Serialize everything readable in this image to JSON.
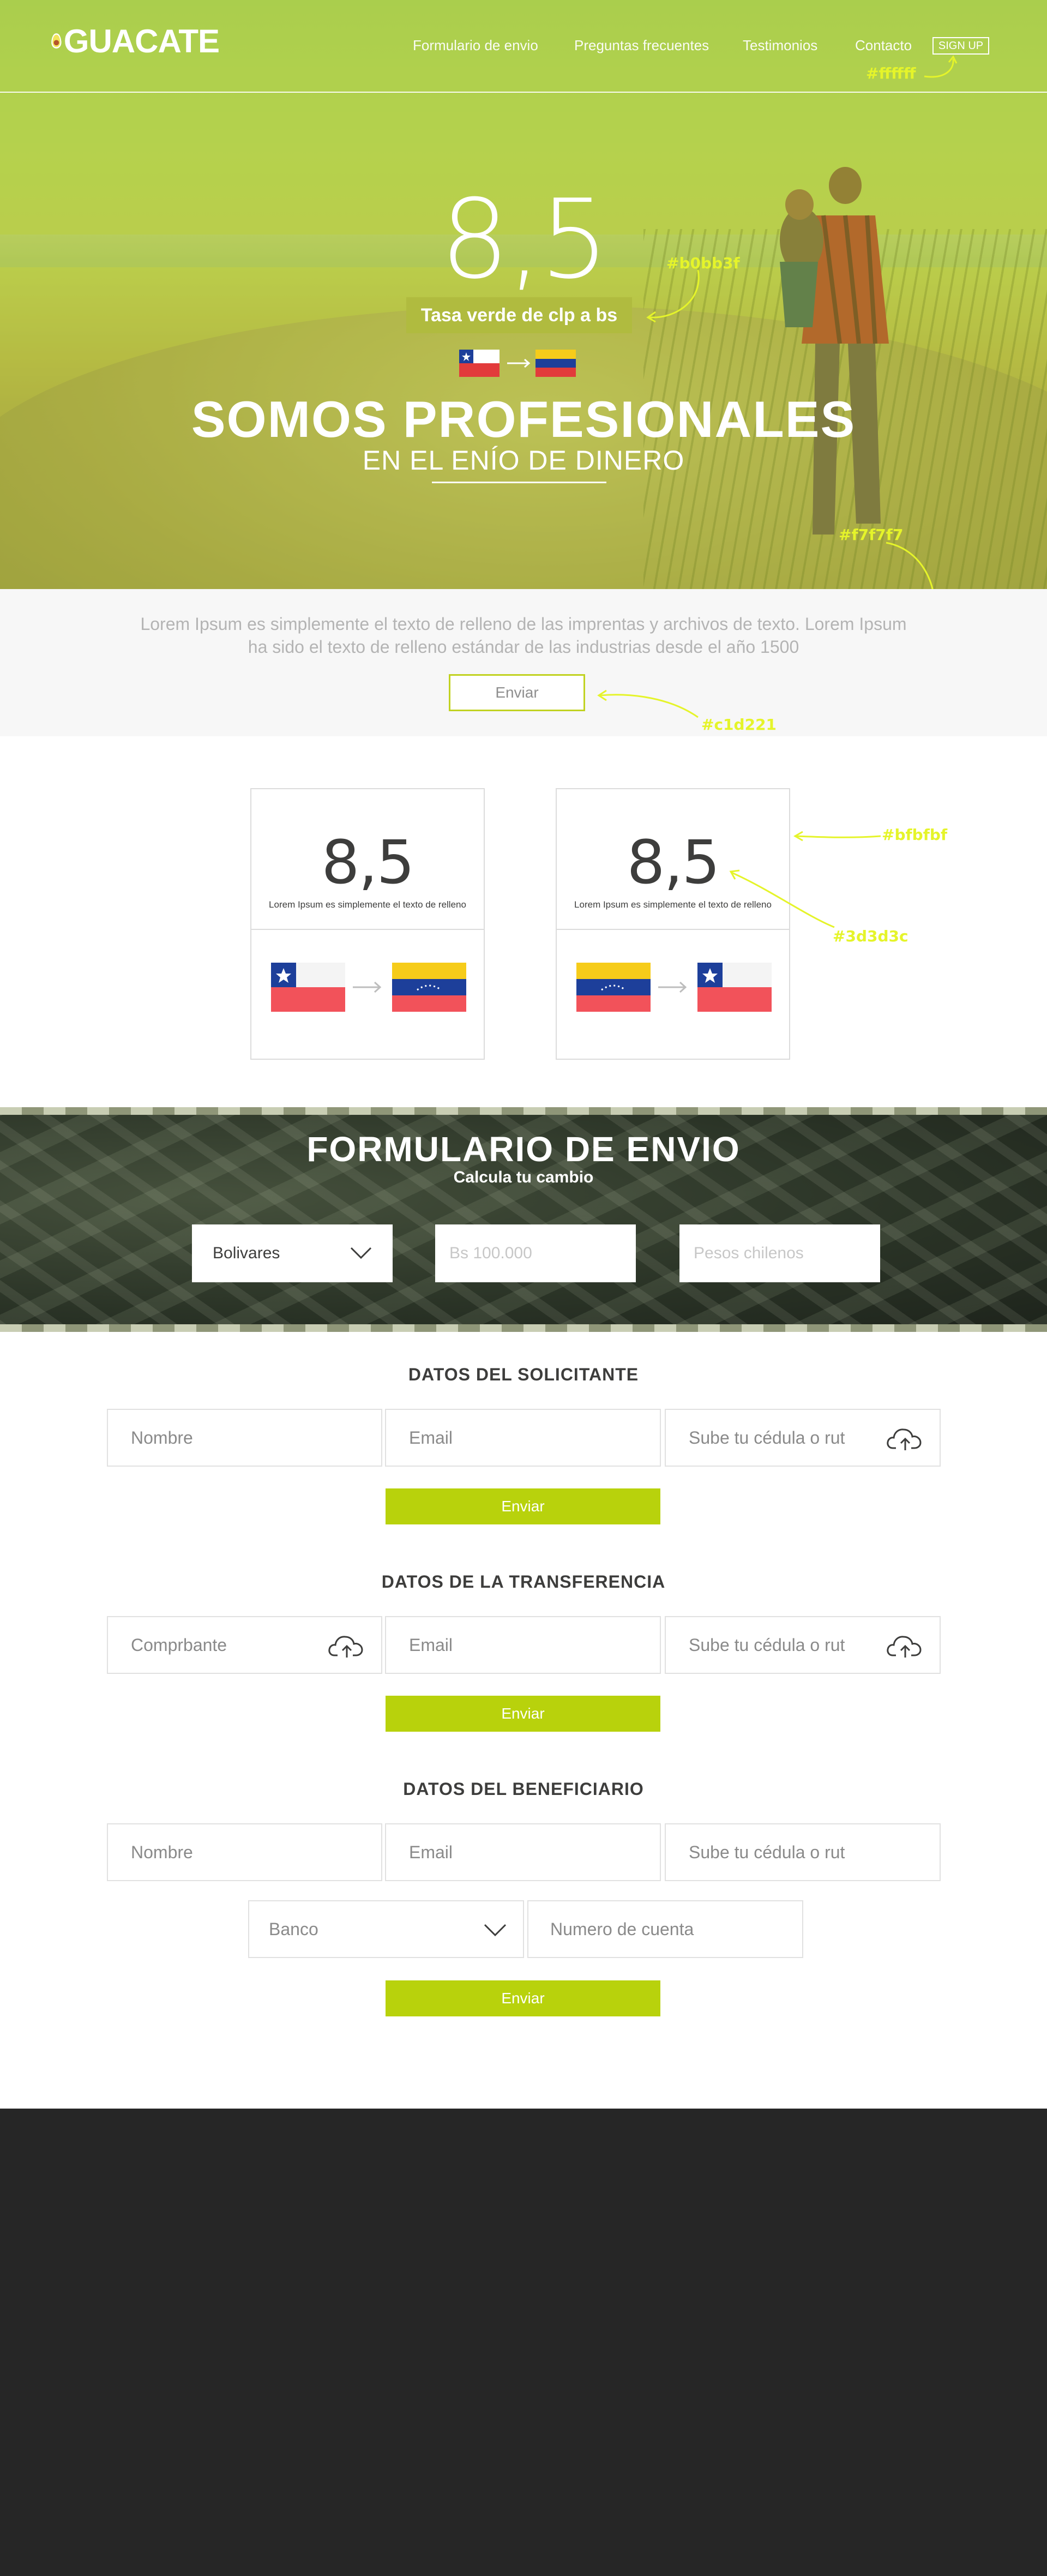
{
  "header": {
    "logo_text": "GUACATE",
    "nav": [
      "Formulario de envio",
      "Preguntas frecuentes",
      "Testimonios",
      "Contacto"
    ],
    "signup": "SIGN UP"
  },
  "hero": {
    "rate": "8,5",
    "rate_label": "Tasa verde de clp a bs",
    "title": "SOMOS PROFESIONALES",
    "subtitle": "EN EL ENÍO DE DINERO"
  },
  "annotations": {
    "white": "#ffffff",
    "tag_color": "#b0bb3f",
    "band_color": "#f7f7f7",
    "button_border": "#c1d221",
    "card_border": "#bfbfbf",
    "card_text": "#3d3d3c"
  },
  "intro": {
    "text": "Lorem Ipsum es simplemente el texto de relleno de las imprentas y archivos de texto. Lorem Ipsum ha sido el texto de relleno estándar de las industrias desde el año 1500",
    "button": "Enviar"
  },
  "cards": [
    {
      "rate": "8,5",
      "caption": "Lorem Ipsum es simplemente el texto de relleno",
      "from": "chile",
      "to": "venezuela"
    },
    {
      "rate": "8,5",
      "caption": "Lorem Ipsum es simplemente el texto de relleno",
      "from": "venezuela",
      "to": "chile"
    }
  ],
  "calculator": {
    "title": "FORMULARIO DE ENVIO",
    "subtitle": "Calcula tu cambio",
    "currency_selected": "Bolivares",
    "amount_placeholder": "Bs 100.000",
    "pesos_placeholder": "Pesos chilenos"
  },
  "solicitante": {
    "title": "DATOS DEL SOLICITANTE",
    "nombre": "Nombre",
    "email": "Email",
    "cedula": "Sube tu cédula o rut",
    "button": "Enviar"
  },
  "transferencia": {
    "title": "DATOS DE LA TRANSFERENCIA",
    "comprobante": "Comprbante",
    "email": "Email",
    "cedula": "Sube tu cédula o rut",
    "button": "Enviar"
  },
  "beneficiario": {
    "title": "DATOS DEL BENEFICIARIO",
    "nombre": "Nombre",
    "email": "Email",
    "cedula": "Sube tu cédula o rut",
    "banco": "Banco",
    "cuenta": "Numero de cuenta",
    "button": "Enviar"
  },
  "colors": {
    "accent_green": "#b8d20c",
    "footer": "#262626",
    "annotation_yellow": "#e5f42a"
  }
}
